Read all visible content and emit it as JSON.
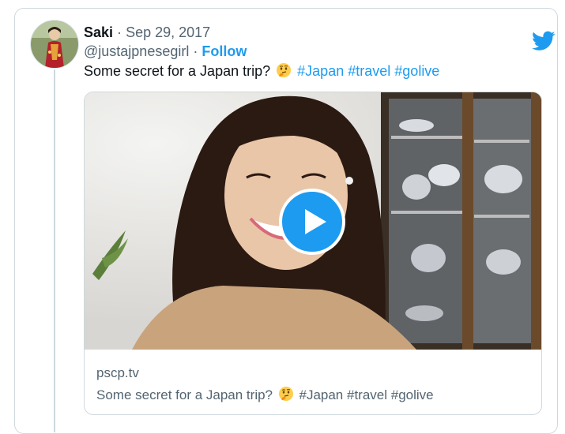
{
  "tweet": {
    "display_name": "Saki",
    "separator": "·",
    "date": "Sep 29, 2017",
    "handle": "@justajpnesegirl",
    "follow_label": "Follow",
    "text": {
      "before": "Some secret for a Japan trip?",
      "emoji": "thinking-face-emoji",
      "hashtags": [
        "#Japan",
        "#travel",
        "#golive"
      ]
    }
  },
  "card": {
    "domain": "pscp.tv",
    "title": {
      "before": "Some secret for a Japan trip?",
      "emoji": "thinking-face-emoji",
      "hashtags": [
        "#Japan",
        "#travel",
        "#golive"
      ]
    }
  },
  "icons": {
    "brand": "twitter-bird-icon",
    "play": "play-icon"
  },
  "colors": {
    "accent": "#1d9bf0",
    "text": "#0f1419",
    "muted": "#536471",
    "border": "#cfd9de"
  }
}
